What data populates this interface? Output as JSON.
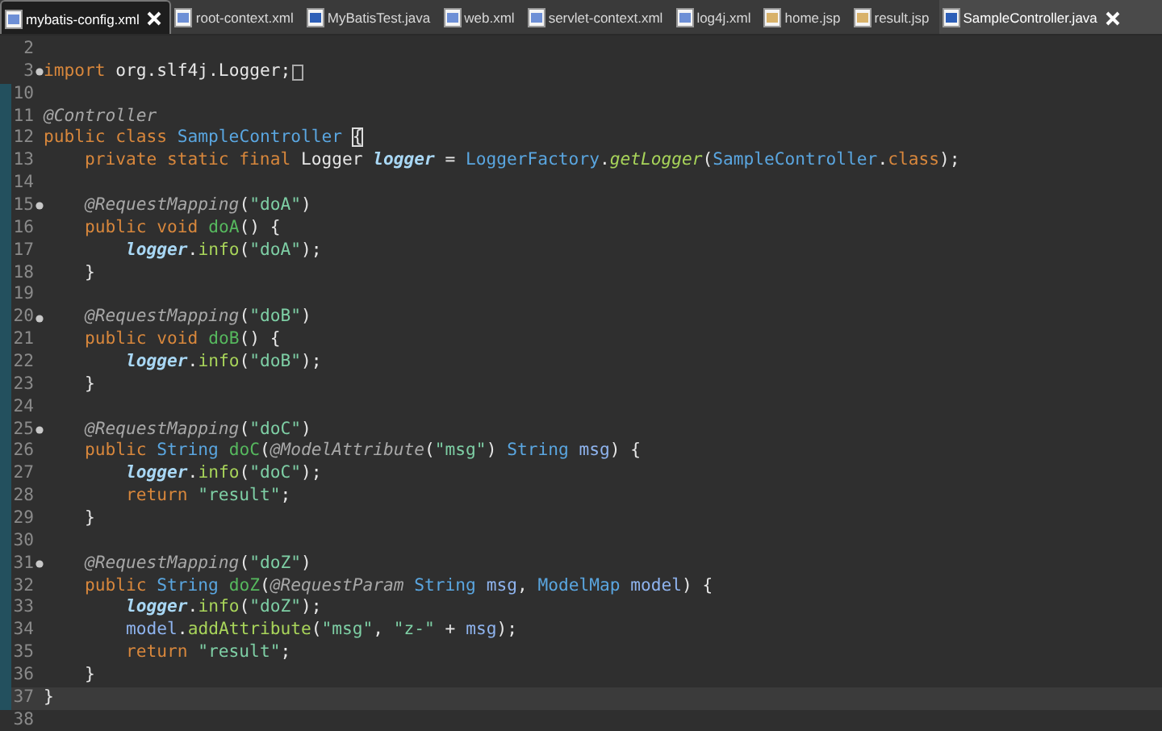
{
  "tabs": [
    {
      "label": "mybatis-config.xml",
      "kind": "xml",
      "selected": false,
      "focused": true,
      "closable": true
    },
    {
      "label": "root-context.xml",
      "kind": "xml",
      "selected": false,
      "focused": false,
      "closable": false
    },
    {
      "label": "MyBatisTest.java",
      "kind": "java",
      "selected": false,
      "focused": false,
      "closable": false
    },
    {
      "label": "web.xml",
      "kind": "xml",
      "selected": false,
      "focused": false,
      "closable": false
    },
    {
      "label": "servlet-context.xml",
      "kind": "xml",
      "selected": false,
      "focused": false,
      "closable": false
    },
    {
      "label": "log4j.xml",
      "kind": "xml",
      "selected": false,
      "focused": false,
      "closable": false
    },
    {
      "label": "home.jsp",
      "kind": "jsp",
      "selected": false,
      "focused": false,
      "closable": false
    },
    {
      "label": "result.jsp",
      "kind": "jsp",
      "selected": false,
      "focused": false,
      "closable": false
    },
    {
      "label": "SampleController.java",
      "kind": "java",
      "selected": true,
      "focused": false,
      "closable": true
    }
  ],
  "lines": [
    {
      "n": "2",
      "fold": false,
      "marked": false,
      "current": false,
      "folded": false
    },
    {
      "n": "3",
      "fold": true,
      "marked": false,
      "current": false,
      "folded": true,
      "tokens": [
        {
          "kind": "kw",
          "text": "import "
        },
        {
          "kind": "plain",
          "text": "org.slf4j.Logger;"
        }
      ]
    },
    {
      "n": "10",
      "fold": false,
      "marked": true,
      "current": false,
      "folded": false
    },
    {
      "n": "11",
      "fold": false,
      "marked": true,
      "current": false,
      "folded": false,
      "tokens": [
        {
          "kind": "ann",
          "text": "@Controller"
        }
      ]
    },
    {
      "n": "12",
      "fold": false,
      "marked": true,
      "current": false,
      "folded": false,
      "tokens": [
        {
          "kind": "kw",
          "text": "public class "
        },
        {
          "kind": "type",
          "text": "SampleController "
        },
        {
          "kind": "match",
          "text": "{"
        }
      ]
    },
    {
      "n": "13",
      "fold": false,
      "marked": true,
      "current": false,
      "folded": false,
      "tokens": [
        {
          "kind": "kw",
          "text": "    private static final "
        },
        {
          "kind": "plain",
          "text": "Logger "
        },
        {
          "kind": "field",
          "text": "logger"
        },
        {
          "kind": "plain",
          "text": " = "
        },
        {
          "kind": "type",
          "text": "LoggerFactory"
        },
        {
          "kind": "plain",
          "text": "."
        },
        {
          "kind": "scall",
          "text": "getLogger"
        },
        {
          "kind": "plain",
          "text": "("
        },
        {
          "kind": "type",
          "text": "SampleController"
        },
        {
          "kind": "plain",
          "text": "."
        },
        {
          "kind": "kw",
          "text": "class"
        },
        {
          "kind": "plain",
          "text": ");"
        }
      ]
    },
    {
      "n": "14",
      "fold": false,
      "marked": true,
      "current": false,
      "folded": false
    },
    {
      "n": "15",
      "fold": true,
      "marked": true,
      "current": false,
      "folded": false,
      "tokens": [
        {
          "kind": "ann",
          "text": "    @RequestMapping"
        },
        {
          "kind": "plain",
          "text": "("
        },
        {
          "kind": "str",
          "text": "\"doA\""
        },
        {
          "kind": "plain",
          "text": ")"
        }
      ]
    },
    {
      "n": "16",
      "fold": false,
      "marked": true,
      "current": false,
      "folded": false,
      "tokens": [
        {
          "kind": "kw",
          "text": "    public void "
        },
        {
          "kind": "decl",
          "text": "doA"
        },
        {
          "kind": "plain",
          "text": "() {"
        }
      ]
    },
    {
      "n": "17",
      "fold": false,
      "marked": true,
      "current": false,
      "folded": false,
      "tokens": [
        {
          "kind": "field",
          "text": "        logger"
        },
        {
          "kind": "plain",
          "text": "."
        },
        {
          "kind": "call",
          "text": "info"
        },
        {
          "kind": "plain",
          "text": "("
        },
        {
          "kind": "str",
          "text": "\"doA\""
        },
        {
          "kind": "plain",
          "text": ");"
        }
      ]
    },
    {
      "n": "18",
      "fold": false,
      "marked": true,
      "current": false,
      "folded": false,
      "tokens": [
        {
          "kind": "plain",
          "text": "    }"
        }
      ]
    },
    {
      "n": "19",
      "fold": false,
      "marked": true,
      "current": false,
      "folded": false
    },
    {
      "n": "20",
      "fold": true,
      "marked": true,
      "current": false,
      "folded": false,
      "tokens": [
        {
          "kind": "ann",
          "text": "    @RequestMapping"
        },
        {
          "kind": "plain",
          "text": "("
        },
        {
          "kind": "str",
          "text": "\"doB\""
        },
        {
          "kind": "plain",
          "text": ")"
        }
      ]
    },
    {
      "n": "21",
      "fold": false,
      "marked": true,
      "current": false,
      "folded": false,
      "tokens": [
        {
          "kind": "kw",
          "text": "    public void "
        },
        {
          "kind": "decl",
          "text": "doB"
        },
        {
          "kind": "plain",
          "text": "() {"
        }
      ]
    },
    {
      "n": "22",
      "fold": false,
      "marked": true,
      "current": false,
      "folded": false,
      "tokens": [
        {
          "kind": "field",
          "text": "        logger"
        },
        {
          "kind": "plain",
          "text": "."
        },
        {
          "kind": "call",
          "text": "info"
        },
        {
          "kind": "plain",
          "text": "("
        },
        {
          "kind": "str",
          "text": "\"doB\""
        },
        {
          "kind": "plain",
          "text": ");"
        }
      ]
    },
    {
      "n": "23",
      "fold": false,
      "marked": true,
      "current": false,
      "folded": false,
      "tokens": [
        {
          "kind": "plain",
          "text": "    }"
        }
      ]
    },
    {
      "n": "24",
      "fold": false,
      "marked": true,
      "current": false,
      "folded": false
    },
    {
      "n": "25",
      "fold": true,
      "marked": true,
      "current": false,
      "folded": false,
      "tokens": [
        {
          "kind": "ann",
          "text": "    @RequestMapping"
        },
        {
          "kind": "plain",
          "text": "("
        },
        {
          "kind": "str",
          "text": "\"doC\""
        },
        {
          "kind": "plain",
          "text": ")"
        }
      ]
    },
    {
      "n": "26",
      "fold": false,
      "marked": true,
      "current": false,
      "folded": false,
      "tokens": [
        {
          "kind": "kw",
          "text": "    public "
        },
        {
          "kind": "type",
          "text": "String "
        },
        {
          "kind": "decl",
          "text": "doC"
        },
        {
          "kind": "plain",
          "text": "("
        },
        {
          "kind": "ann",
          "text": "@ModelAttribute"
        },
        {
          "kind": "plain",
          "text": "("
        },
        {
          "kind": "str",
          "text": "\"msg\""
        },
        {
          "kind": "plain",
          "text": ") "
        },
        {
          "kind": "type",
          "text": "String "
        },
        {
          "kind": "var",
          "text": "msg"
        },
        {
          "kind": "plain",
          "text": ") {"
        }
      ]
    },
    {
      "n": "27",
      "fold": false,
      "marked": true,
      "current": false,
      "folded": false,
      "tokens": [
        {
          "kind": "field",
          "text": "        logger"
        },
        {
          "kind": "plain",
          "text": "."
        },
        {
          "kind": "call",
          "text": "info"
        },
        {
          "kind": "plain",
          "text": "("
        },
        {
          "kind": "str",
          "text": "\"doC\""
        },
        {
          "kind": "plain",
          "text": ");"
        }
      ]
    },
    {
      "n": "28",
      "fold": false,
      "marked": true,
      "current": false,
      "folded": false,
      "tokens": [
        {
          "kind": "kw",
          "text": "        return "
        },
        {
          "kind": "str",
          "text": "\"result\""
        },
        {
          "kind": "plain",
          "text": ";"
        }
      ]
    },
    {
      "n": "29",
      "fold": false,
      "marked": true,
      "current": false,
      "folded": false,
      "tokens": [
        {
          "kind": "plain",
          "text": "    }"
        }
      ]
    },
    {
      "n": "30",
      "fold": false,
      "marked": true,
      "current": false,
      "folded": false
    },
    {
      "n": "31",
      "fold": true,
      "marked": true,
      "current": false,
      "folded": false,
      "tokens": [
        {
          "kind": "ann",
          "text": "    @RequestMapping"
        },
        {
          "kind": "plain",
          "text": "("
        },
        {
          "kind": "str",
          "text": "\"doZ\""
        },
        {
          "kind": "plain",
          "text": ")"
        }
      ]
    },
    {
      "n": "32",
      "fold": false,
      "marked": true,
      "current": false,
      "folded": false,
      "tokens": [
        {
          "kind": "kw",
          "text": "    public "
        },
        {
          "kind": "type",
          "text": "String "
        },
        {
          "kind": "decl",
          "text": "doZ"
        },
        {
          "kind": "plain",
          "text": "("
        },
        {
          "kind": "ann",
          "text": "@RequestParam "
        },
        {
          "kind": "type",
          "text": "String "
        },
        {
          "kind": "var",
          "text": "msg"
        },
        {
          "kind": "plain",
          "text": ", "
        },
        {
          "kind": "type",
          "text": "ModelMap "
        },
        {
          "kind": "var",
          "text": "model"
        },
        {
          "kind": "plain",
          "text": ") {"
        }
      ]
    },
    {
      "n": "33",
      "fold": false,
      "marked": true,
      "current": false,
      "folded": false,
      "tokens": [
        {
          "kind": "field",
          "text": "        logger"
        },
        {
          "kind": "plain",
          "text": "."
        },
        {
          "kind": "call",
          "text": "info"
        },
        {
          "kind": "plain",
          "text": "("
        },
        {
          "kind": "str",
          "text": "\"doZ\""
        },
        {
          "kind": "plain",
          "text": ");"
        }
      ]
    },
    {
      "n": "34",
      "fold": false,
      "marked": true,
      "current": false,
      "folded": false,
      "tokens": [
        {
          "kind": "var",
          "text": "        model"
        },
        {
          "kind": "plain",
          "text": "."
        },
        {
          "kind": "call",
          "text": "addAttribute"
        },
        {
          "kind": "plain",
          "text": "("
        },
        {
          "kind": "str",
          "text": "\"msg\""
        },
        {
          "kind": "plain",
          "text": ", "
        },
        {
          "kind": "str",
          "text": "\"z-\""
        },
        {
          "kind": "plain",
          "text": " + "
        },
        {
          "kind": "var",
          "text": "msg"
        },
        {
          "kind": "plain",
          "text": ");"
        }
      ]
    },
    {
      "n": "35",
      "fold": false,
      "marked": true,
      "current": false,
      "folded": false,
      "tokens": [
        {
          "kind": "kw",
          "text": "        return "
        },
        {
          "kind": "str",
          "text": "\"result\""
        },
        {
          "kind": "plain",
          "text": ";"
        }
      ]
    },
    {
      "n": "36",
      "fold": false,
      "marked": true,
      "current": false,
      "folded": false,
      "tokens": [
        {
          "kind": "plain",
          "text": "    }"
        }
      ]
    },
    {
      "n": "37",
      "fold": false,
      "marked": true,
      "current": true,
      "folded": false,
      "tokens": [
        {
          "kind": "plain",
          "text": "}"
        }
      ]
    },
    {
      "n": "38",
      "fold": false,
      "marked": false,
      "current": false,
      "folded": false
    }
  ]
}
